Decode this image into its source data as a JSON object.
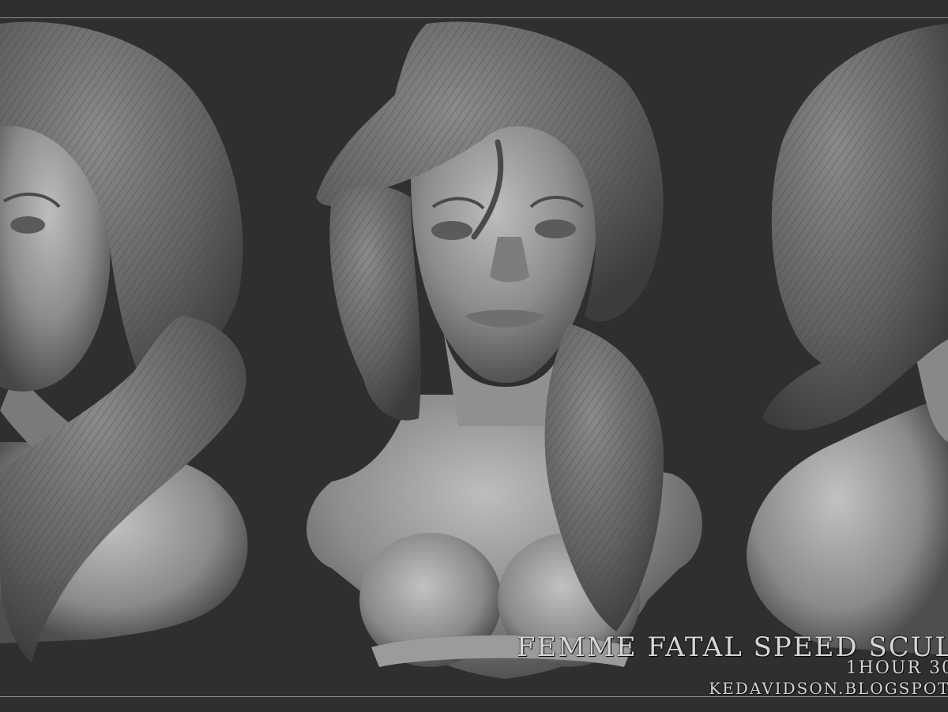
{
  "image": {
    "subject": "three-view bust sculpt",
    "views": [
      "left three-quarter view",
      "front view",
      "back three-quarter view"
    ]
  },
  "caption": {
    "title": "FEMME FATAL SPEED SCUL",
    "time": "1HOUR 30",
    "url": "KEDAVIDSON.BLOGSPOT."
  },
  "colors": {
    "background": "#2f2f2f",
    "clay": "#8c8c8c",
    "clay_light": "#bdbdbd",
    "clay_dark": "#4a4a4a",
    "caption_text": "#d6d6d6"
  }
}
